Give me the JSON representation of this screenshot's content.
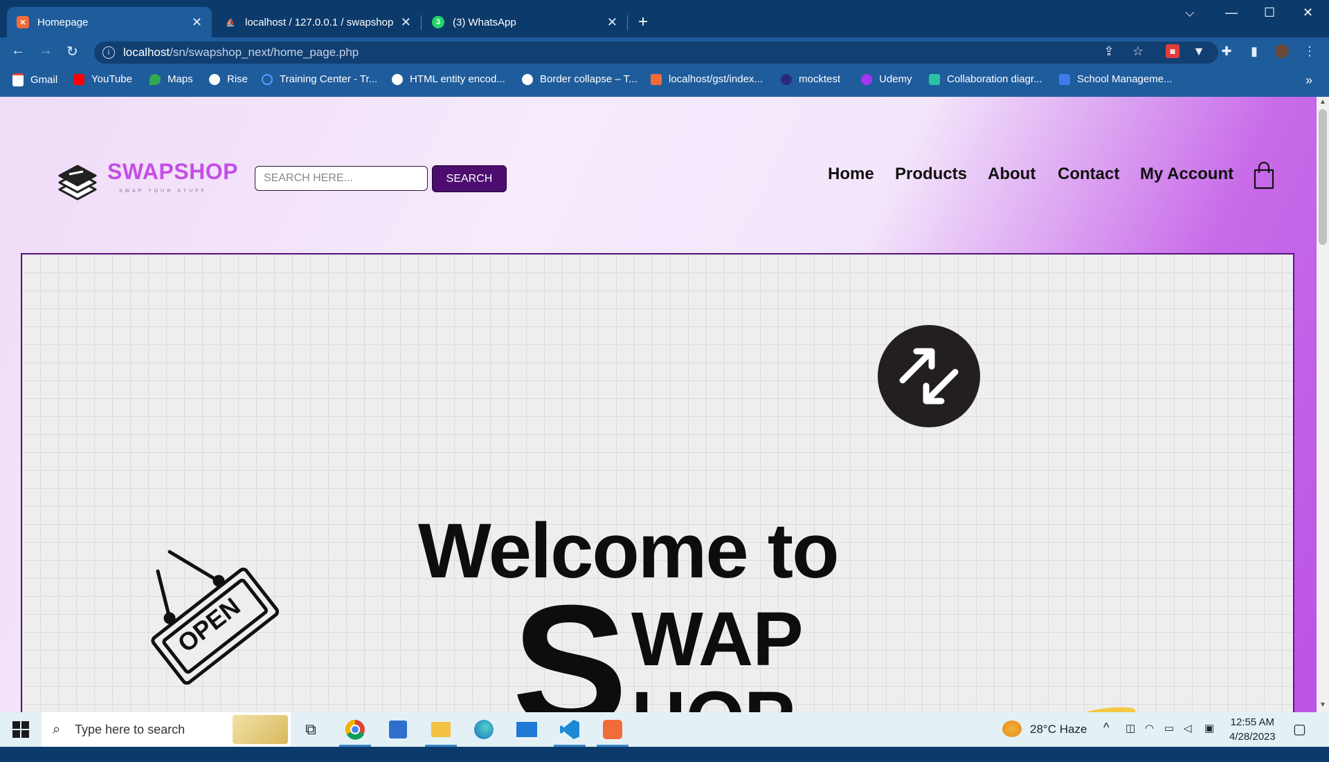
{
  "browser": {
    "tabs": [
      {
        "title": "Homepage",
        "active": true
      },
      {
        "title": "localhost / 127.0.0.1 / swapshop_",
        "active": false
      },
      {
        "title": "(3) WhatsApp",
        "active": false
      }
    ],
    "url_host": "localhost",
    "url_path": "/sn/swapshop_next/home_page.php",
    "bookmarks": [
      "Gmail",
      "YouTube",
      "Maps",
      "Rise",
      "Training Center - Tr...",
      "HTML entity encod...",
      "Border collapse – T...",
      "localhost/gst/index...",
      "mocktest",
      "Udemy",
      "Collaboration diagr...",
      "School Manageme..."
    ],
    "more_bookmarks": "»"
  },
  "site": {
    "logo_text": "SWAPSHOP",
    "logo_tagline": "SWAP YOUR STUFF",
    "search_placeholder": "SEARCH HERE...",
    "search_button": "SEARCH",
    "nav": [
      "Home",
      "Products",
      "About",
      "Contact",
      "My Account"
    ],
    "hero": {
      "welcome": "Welcome to",
      "big_letter": "S",
      "line1": "WAP",
      "line2": "HOP",
      "sign_text": "OPEN"
    }
  },
  "taskbar": {
    "search_placeholder": "Type here to search",
    "weather": "28°C  Haze",
    "time": "12:55 AM",
    "date": "4/28/2023"
  },
  "colors": {
    "chrome_frame": "#0c3a6b",
    "chrome_toolbar": "#1f5c9c",
    "brand_purple": "#c54ee6",
    "button_purple": "#4c0d6f"
  }
}
